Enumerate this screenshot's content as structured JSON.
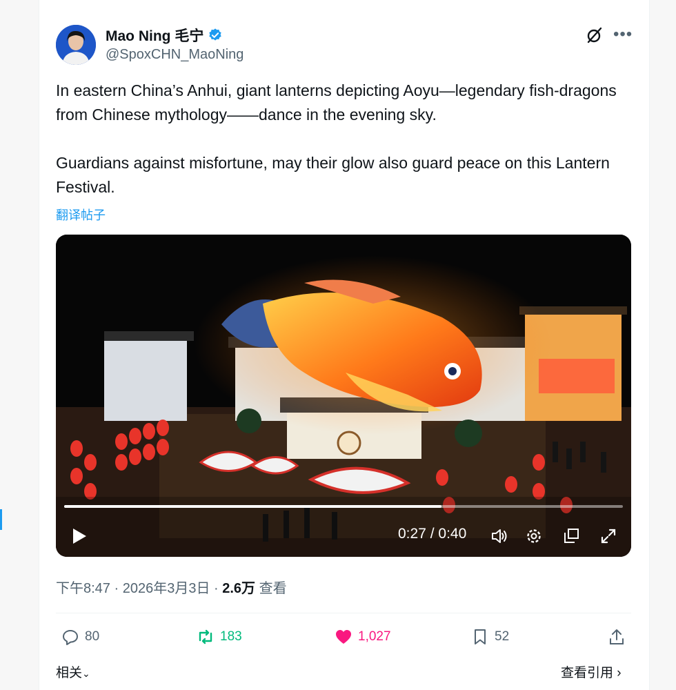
{
  "author": {
    "name": "Mao Ning 毛宁",
    "handle": "@SpoxCHN_MaoNing",
    "verified": true
  },
  "tweet": {
    "paragraph_1": "In eastern China’s Anhui, giant lanterns depicting Aoyu—legendary fish-dragons from Chinese mythology——dance in the evening sky.",
    "paragraph_2": "Guardians against misfortune, may their glow also guard peace on this Lantern Festival.",
    "translate_link": "翻译帖子"
  },
  "video": {
    "current_time": "0:27",
    "separator": " / ",
    "duration": "0:40",
    "progress_fraction": 0.675
  },
  "meta": {
    "time": "下午8:47",
    "date": "2026年3月3日",
    "views_count": "2.6万",
    "views_label": " 查看",
    "dot": " · "
  },
  "actions": {
    "replies": "80",
    "reposts": "183",
    "likes": "1,027",
    "bookmarks": "52"
  },
  "footer": {
    "related": "相关",
    "view_quotes": "查看引用"
  },
  "colors": {
    "accent": "#1d9bf0",
    "repost": "#00ba7c",
    "like": "#f91880",
    "muted": "#536471"
  },
  "icons": [
    "verified-badge-icon",
    "grok-icon",
    "more-icon",
    "play-icon",
    "volume-icon",
    "settings-icon",
    "popout-icon",
    "fullscreen-icon",
    "reply-icon",
    "repost-icon",
    "like-icon",
    "bookmark-icon",
    "share-icon",
    "chevron-down-icon",
    "chevron-right-icon"
  ]
}
